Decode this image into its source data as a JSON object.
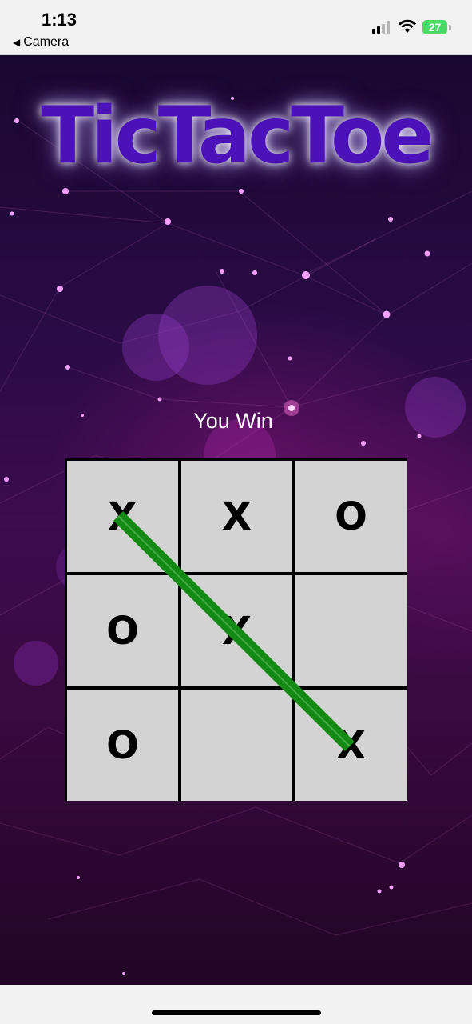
{
  "status_bar": {
    "time": "1:13",
    "back_label": "Camera",
    "battery": "27"
  },
  "game": {
    "title": "TicTacToe",
    "result": "You Win",
    "board": [
      [
        "X",
        "X",
        "O"
      ],
      [
        "O",
        "X",
        ""
      ],
      [
        "O",
        "",
        "X"
      ]
    ],
    "winning_line": "diagonal top-left to bottom-right",
    "win_line_color": "#138a13"
  }
}
